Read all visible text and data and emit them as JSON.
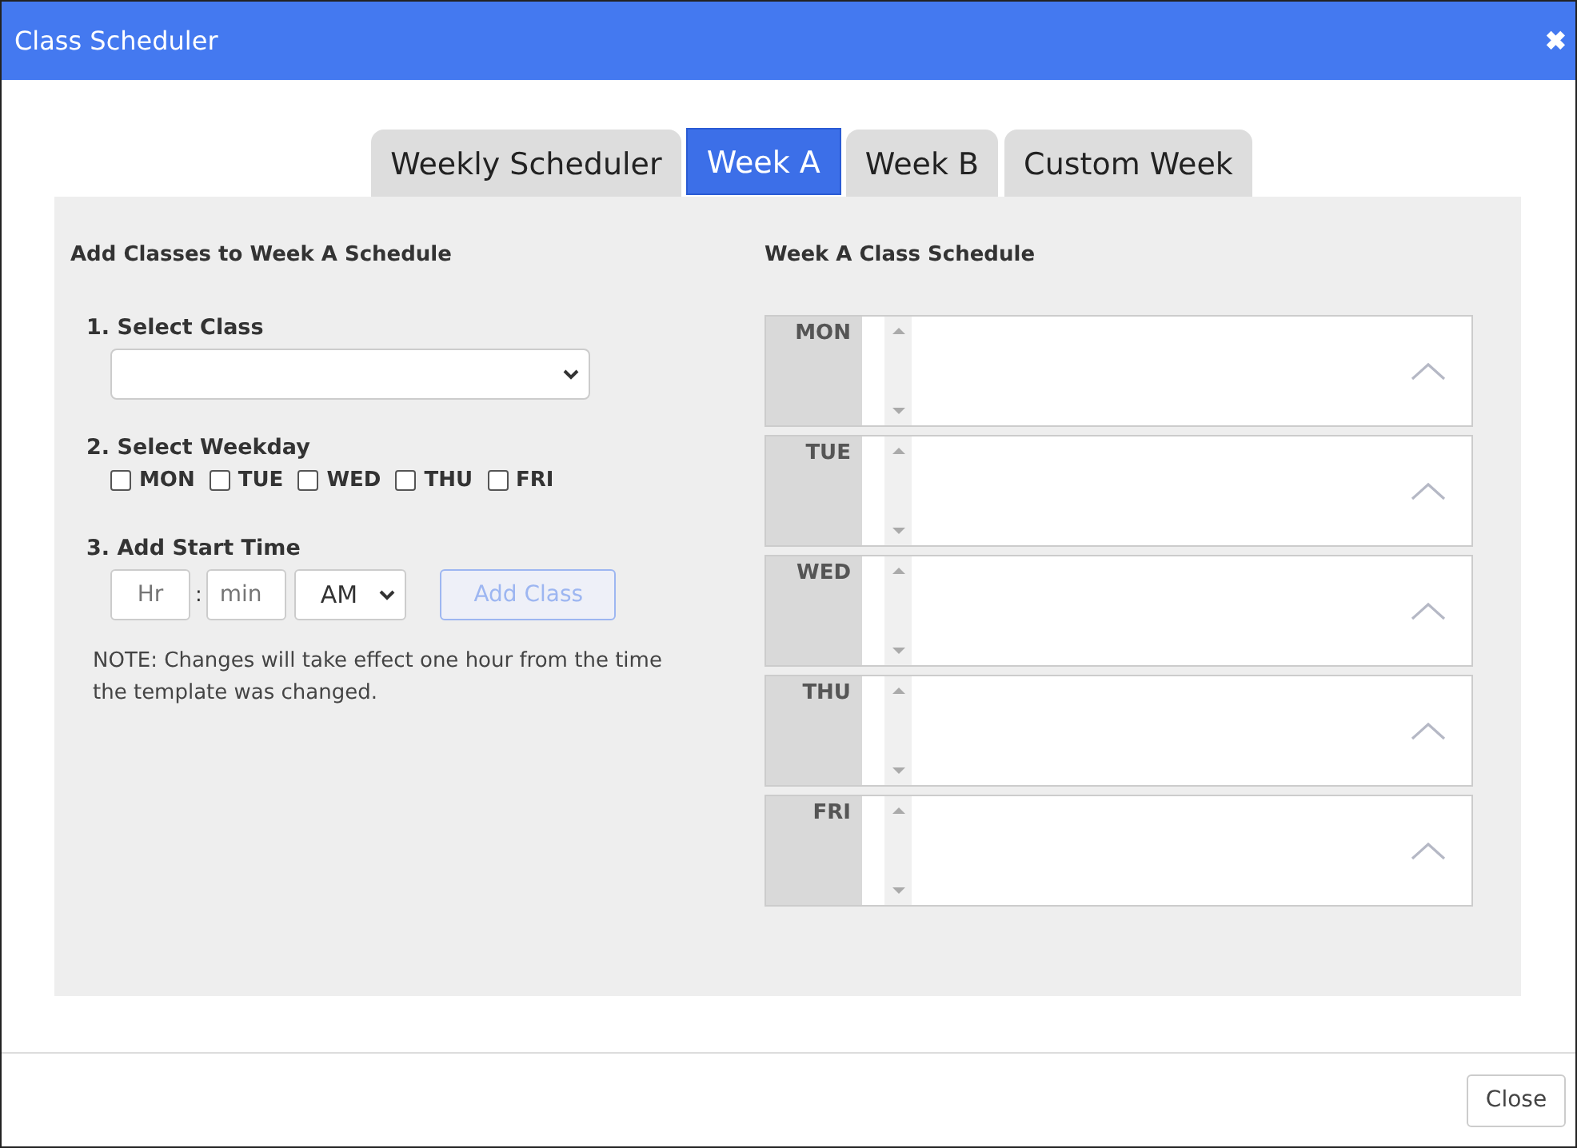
{
  "window": {
    "title": "Class Scheduler",
    "close_icon": "✖"
  },
  "tabs": [
    {
      "label": "Weekly Scheduler",
      "selected": false
    },
    {
      "label": "Week A",
      "selected": true
    },
    {
      "label": "Week B",
      "selected": false
    },
    {
      "label": "Custom Week",
      "selected": false
    }
  ],
  "add_form": {
    "heading": "Add Classes to Week A Schedule",
    "class_step": {
      "label": "1. Select Class"
    },
    "weekday_step": {
      "label": "2. Select Weekday",
      "days": [
        {
          "label": "MON",
          "checked": false
        },
        {
          "label": "TUE",
          "checked": false
        },
        {
          "label": "WED",
          "checked": false
        },
        {
          "label": "THU",
          "checked": false
        },
        {
          "label": "FRI",
          "checked": false
        }
      ]
    },
    "time_step": {
      "label": "3. Add Start Time",
      "hour": {
        "placeholder": "Hr"
      },
      "separator": ":",
      "minute": {
        "placeholder": "min"
      },
      "period": {
        "value": "AM"
      },
      "add_button": {
        "label": "Add Class",
        "disabled": true
      }
    },
    "note": "NOTE: Changes will take effect one hour from the time the template was changed."
  },
  "schedule": {
    "heading": "Week A Class Schedule",
    "days": [
      {
        "label": "MON"
      },
      {
        "label": "TUE"
      },
      {
        "label": "WED"
      },
      {
        "label": "THU"
      },
      {
        "label": "FRI"
      }
    ]
  },
  "footer": {
    "close_button": "Close"
  }
}
